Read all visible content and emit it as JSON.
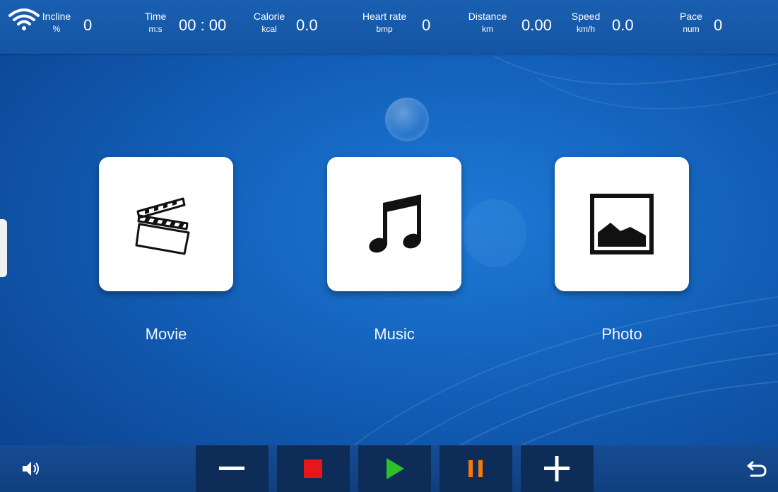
{
  "stats": [
    {
      "label": "Incline",
      "unit": "%",
      "value": "0"
    },
    {
      "label": "Time",
      "unit": "m:s",
      "value": "00 : 00"
    },
    {
      "label": "Calorie",
      "unit": "kcal",
      "value": "0.0"
    },
    {
      "label": "Heart rate",
      "unit": "bmp",
      "value": "0"
    },
    {
      "label": "Distance",
      "unit": "km",
      "value": "0.00"
    },
    {
      "label": "Speed",
      "unit": "km/h",
      "value": "0.0"
    },
    {
      "label": "Pace",
      "unit": "num",
      "value": "0"
    }
  ],
  "tiles": [
    {
      "label": "Movie",
      "icon": "clapperboard-icon"
    },
    {
      "label": "Music",
      "icon": "music-note-icon"
    },
    {
      "label": "Photo",
      "icon": "image-icon"
    }
  ],
  "controls": {
    "decrease": {
      "icon": "minus-icon",
      "color": "#ffffff"
    },
    "stop": {
      "icon": "stop-icon",
      "color": "#e8161b"
    },
    "play": {
      "icon": "play-icon",
      "color": "#2bc12b"
    },
    "pause": {
      "icon": "pause-icon",
      "color": "#f07a10"
    },
    "increase": {
      "icon": "plus-icon",
      "color": "#ffffff"
    }
  },
  "colors": {
    "background": "#125fb8",
    "topbar": "#1659a9",
    "control_button": "#0d2c57",
    "tile": "#ffffff"
  }
}
